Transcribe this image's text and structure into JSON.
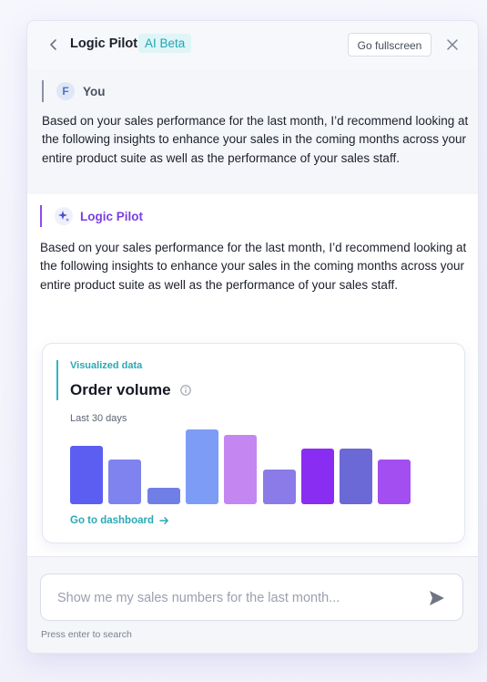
{
  "header": {
    "title": "Logic Pilot",
    "badge": "AI Beta",
    "fullscreen_label": "Go fullscreen"
  },
  "user_message": {
    "avatar_initial": "F",
    "author": "You",
    "text": "Based on your sales performance for the last month, I’d recommend looking at the following insights to enhance your sales in the coming months across your entire product suite as well as the performance of your sales staff."
  },
  "assistant_message": {
    "author": "Logic Pilot",
    "text": "Based on your sales performance for the last month, I’d recommend looking at the following insights to enhance your sales in the coming months across your entire product suite as well as the performance of your sales staff.",
    "card": {
      "eyebrow": "Visualized data",
      "title": "Order volume",
      "subtitle": "Last 30 days",
      "link_label": "Go to dashboard"
    }
  },
  "chart_data": {
    "type": "bar",
    "values": [
      64,
      49,
      18,
      82,
      76,
      38,
      61,
      61,
      49
    ],
    "colors": [
      "#5b5ef0",
      "#7f83ef",
      "#6f7fe6",
      "#7d9cf5",
      "#c487f1",
      "#8a7be8",
      "#8a2df2",
      "#6a69d6",
      "#a24ef0"
    ],
    "ylim": [
      0,
      84
    ]
  },
  "composer": {
    "placeholder": "Show me my sales numbers for the last month...",
    "hint": "Press enter to search"
  },
  "icons": {
    "back": "chevron-left-icon",
    "close": "close-icon",
    "assistant": "sparkle-icon",
    "info": "info-icon",
    "link": "arrow-right-icon",
    "send": "send-icon"
  }
}
